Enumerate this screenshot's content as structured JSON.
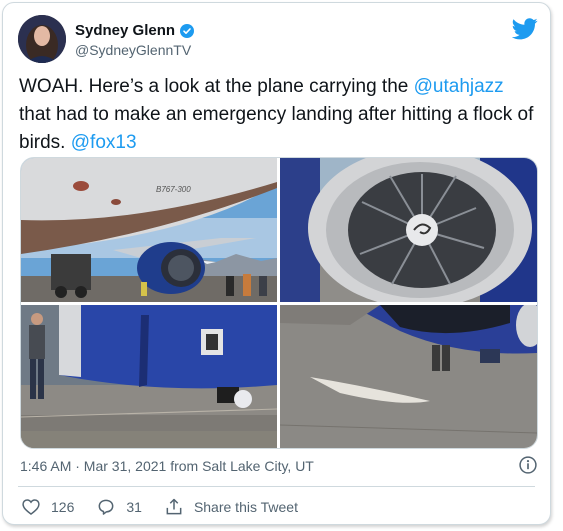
{
  "author": {
    "name": "Sydney Glenn",
    "handle": "@SydneyGlennTV"
  },
  "tweet": {
    "text_1": "WOAH. Here’s a look at the plane carrying the ",
    "mention_1": "@utahjazz",
    "text_2": " that had to make an emergency landing after hitting a flock of birds. ",
    "mention_2": "@fox13"
  },
  "media": {
    "photo1_fuselage_text": "B767-300"
  },
  "meta": {
    "timestamp": "1:46 AM · Mar 31, 2021 from Salt Lake City, UT"
  },
  "actions": {
    "likes": "126",
    "replies": "31",
    "share_label": "Share this Tweet"
  },
  "colors": {
    "accent": "#1d9bf0",
    "text": "#0f1419",
    "secondary": "#536471"
  },
  "icons": [
    "verified-badge-icon",
    "twitter-bird-icon",
    "info-icon",
    "heart-icon",
    "reply-icon",
    "share-icon"
  ]
}
